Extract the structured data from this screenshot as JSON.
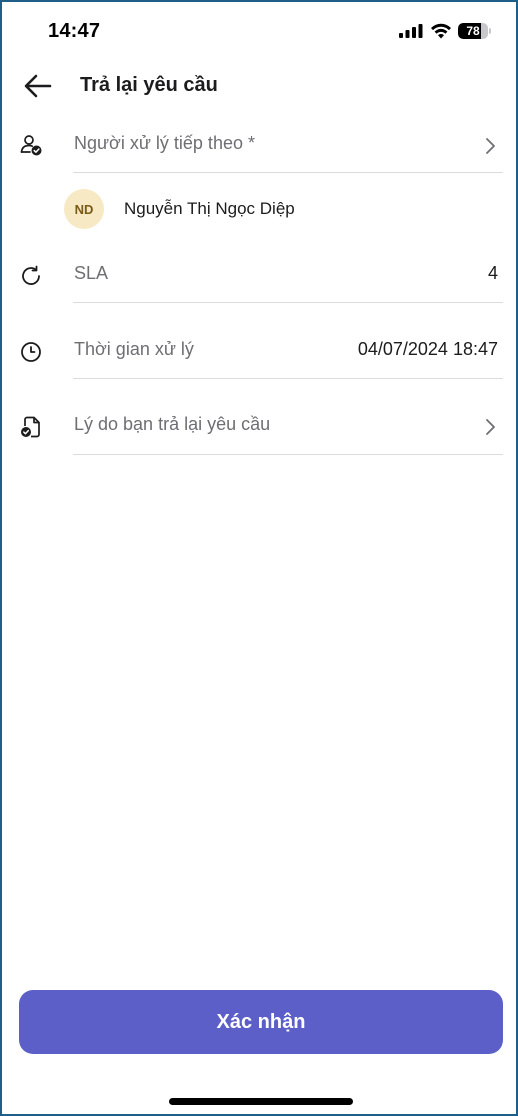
{
  "status_bar": {
    "time": "14:47",
    "battery_level": "78",
    "battery_fraction": 0.78
  },
  "header": {
    "title": "Trả lại yêu cầu",
    "back_icon": "arrow-left-icon"
  },
  "form": {
    "next_handler": {
      "label": "Người xử lý tiếp theo *",
      "icon": "user-check-icon",
      "selected": {
        "initials": "ND",
        "name": "Nguyễn Thị Ngọc Diệp"
      }
    },
    "sla": {
      "label": "SLA",
      "value": "4",
      "icon": "refresh-icon"
    },
    "processing_time": {
      "label": "Thời gian xử lý",
      "value": "04/07/2024 18:47",
      "icon": "clock-icon"
    },
    "reason": {
      "label": "Lý do bạn trả lại yêu cầu",
      "icon": "document-check-icon"
    }
  },
  "actions": {
    "confirm_label": "Xác nhận"
  },
  "colors": {
    "accent": "#5b5fc7",
    "avatar_bg": "#f6e9c4",
    "avatar_text": "#7a5a16",
    "divider": "#dcdcdf",
    "label": "#6e6e73"
  }
}
